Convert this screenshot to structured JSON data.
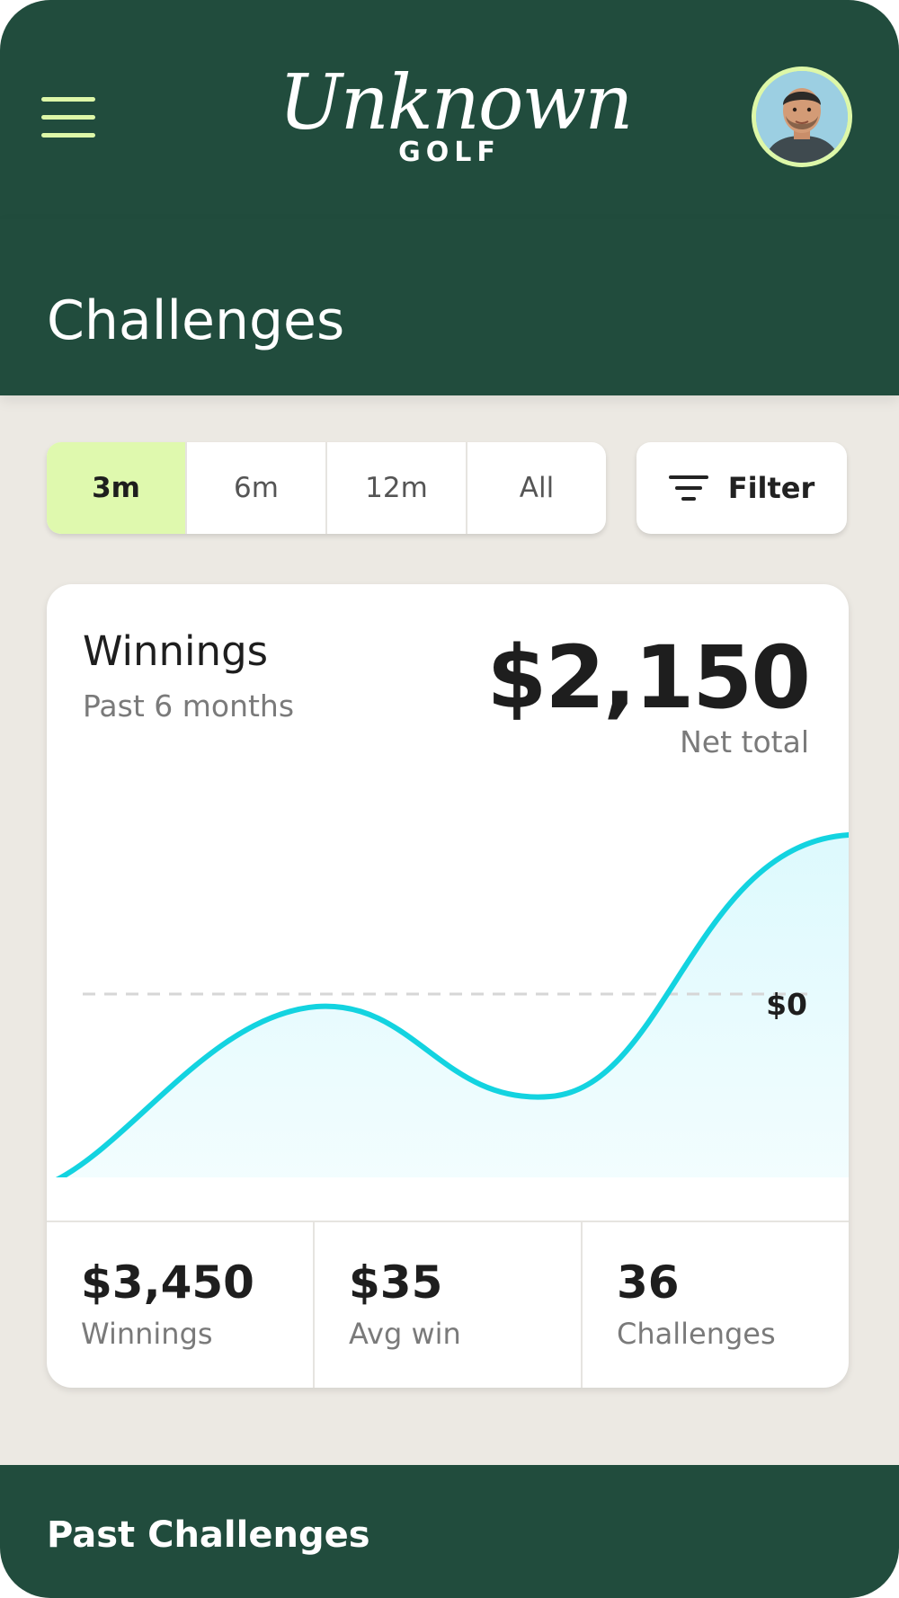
{
  "header": {
    "logo_script": "Unknown",
    "logo_sub": "GOLF"
  },
  "page": {
    "title": "Challenges"
  },
  "range_tabs": [
    {
      "label": "3m",
      "active": true
    },
    {
      "label": "6m",
      "active": false
    },
    {
      "label": "12m",
      "active": false
    },
    {
      "label": "All",
      "active": false
    }
  ],
  "filter": {
    "label": "Filter"
  },
  "winnings_card": {
    "title": "Winnings",
    "subtitle": "Past 6 months",
    "net_total": "$2,150",
    "net_total_label": "Net total",
    "zero_label": "$0"
  },
  "stats": [
    {
      "value": "$3,450",
      "label": "Winnings"
    },
    {
      "value": "$35",
      "label": "Avg win"
    },
    {
      "value": "36",
      "label": "Challenges"
    }
  ],
  "past_challenges": {
    "title": "Past Challenges"
  },
  "colors": {
    "brand_green": "#214C3D",
    "accent_lime": "#DFF9AE",
    "chart_line": "#13D3E0",
    "chart_fill": "#E4FBFF"
  }
}
